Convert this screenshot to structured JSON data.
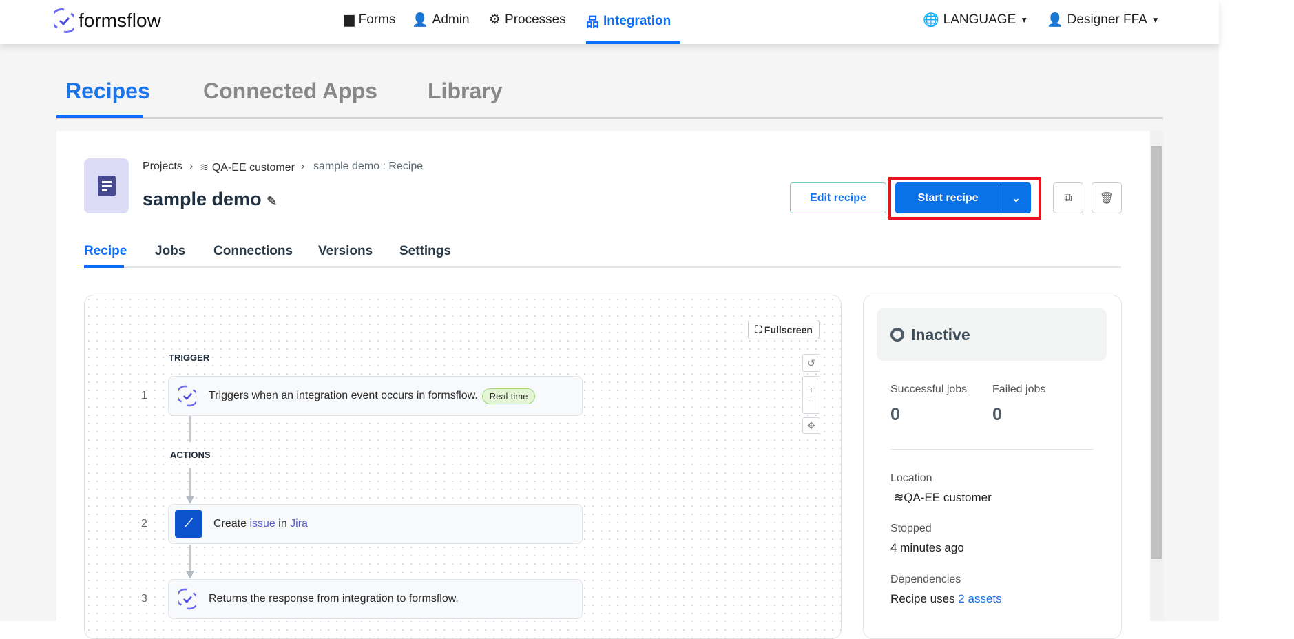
{
  "header": {
    "logo": "formsflow",
    "nav": [
      {
        "label": "Forms",
        "icon": "file-icon"
      },
      {
        "label": "Admin",
        "icon": "user-check-icon"
      },
      {
        "label": "Processes",
        "icon": "cogs-icon"
      },
      {
        "label": "Integration",
        "icon": "sitemap-icon",
        "active": true
      }
    ],
    "language": "LANGUAGE",
    "user": "Designer FFA"
  },
  "tabs": [
    "Recipes",
    "Connected Apps",
    "Library"
  ],
  "breadcrumb": {
    "projects": "Projects",
    "folder": "QA-EE customer",
    "current": "sample demo : Recipe"
  },
  "recipe": {
    "title": "sample demo",
    "edit_label": "Edit recipe",
    "start_label": "Start recipe"
  },
  "subtabs": [
    "Recipe",
    "Jobs",
    "Connections",
    "Versions",
    "Settings"
  ],
  "canvas": {
    "fullscreen": "Fullscreen",
    "trigger_label": "TRIGGER",
    "actions_label": "ACTIONS",
    "steps": [
      {
        "num": "1",
        "text": "Triggers when an integration event occurs in formsflow.",
        "badge": "Real-time"
      },
      {
        "num": "2",
        "pre": "Create ",
        "obj": "issue",
        "mid": " in ",
        "app": "Jira"
      },
      {
        "num": "3",
        "text": "Returns the response from integration to formsflow."
      }
    ]
  },
  "status": {
    "state": "Inactive",
    "successful_label": "Successful jobs",
    "successful": "0",
    "failed_label": "Failed jobs",
    "failed": "0",
    "location_label": "Location",
    "location": "QA-EE customer",
    "stopped_label": "Stopped",
    "stopped": "4 minutes ago",
    "deps_label": "Dependencies",
    "deps_pre": "Recipe uses ",
    "deps_link": "2 assets"
  },
  "colors": {
    "accent": "#0d6efd",
    "highlight": "#e8141c",
    "badge": "#e3f5d4"
  }
}
